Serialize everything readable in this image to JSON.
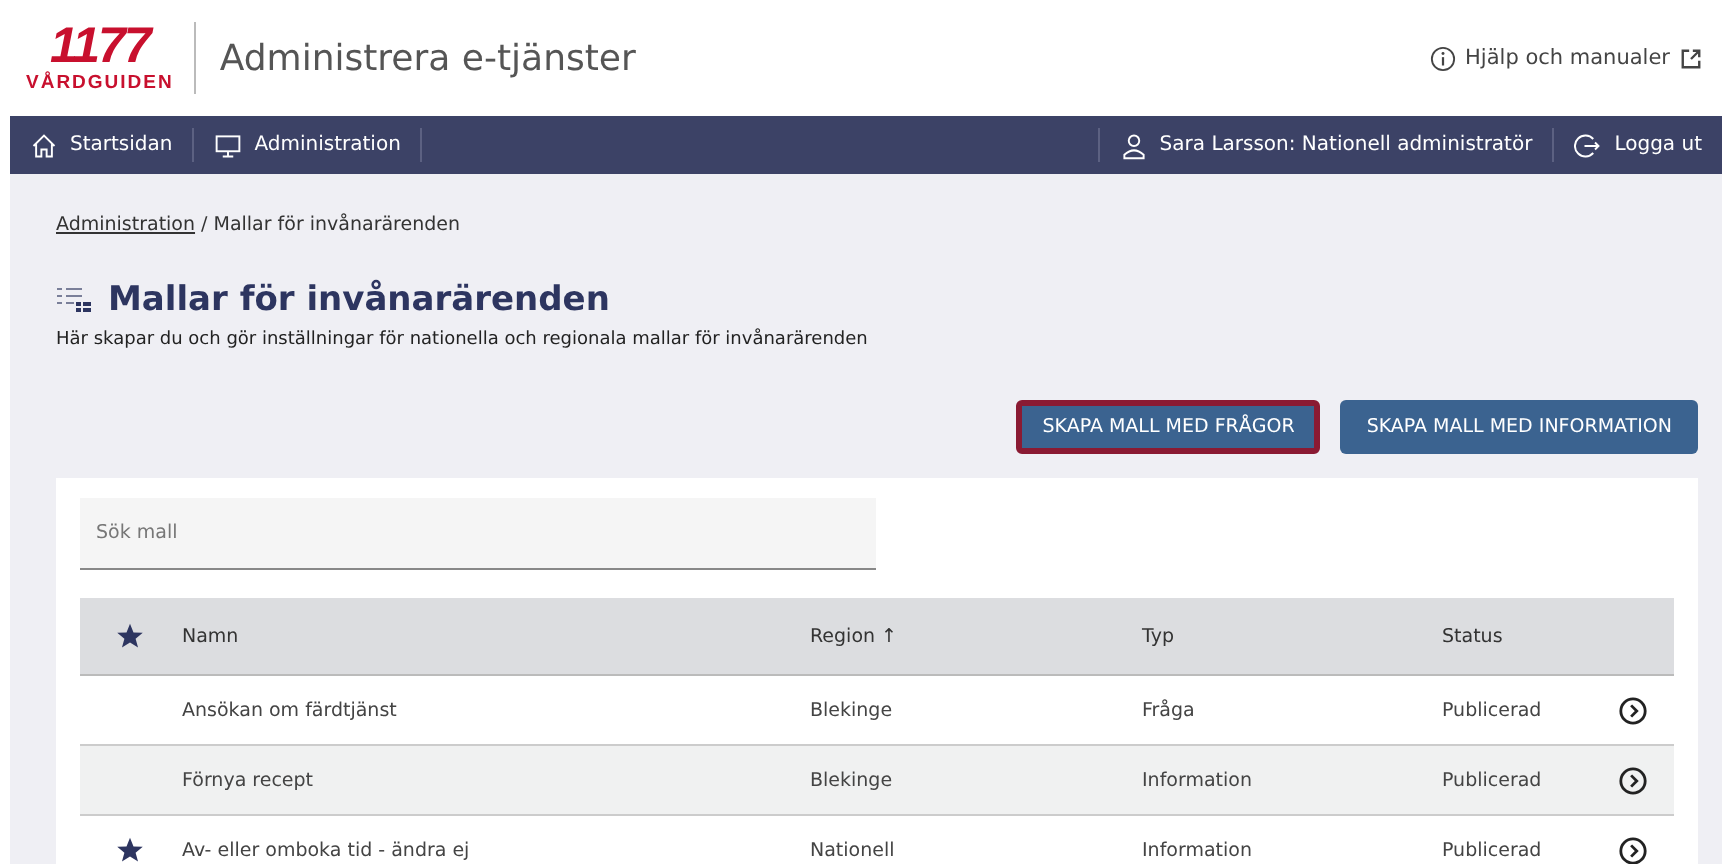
{
  "logo": {
    "number": "1177",
    "name": "VÅRDGUIDEN"
  },
  "app_title": "Administrera e-tjänster",
  "help_link": "Hjälp och manualer",
  "nav": {
    "left": [
      {
        "kind": "home",
        "label": "Startsidan"
      },
      {
        "kind": "monitor",
        "label": "Administration"
      }
    ],
    "right": [
      {
        "kind": "user",
        "label": "Sara Larsson: Nationell administratör"
      },
      {
        "kind": "logout",
        "label": "Logga ut"
      }
    ]
  },
  "breadcrumb": {
    "link": "Administration",
    "current": " / Mallar för invånarärenden"
  },
  "page": {
    "title": "Mallar för invånarärenden",
    "description": "Här skapar du och gör inställningar för nationella och regionala mallar för invånarärenden"
  },
  "buttons": [
    {
      "label": "SKAPA MALL MED FRÅGOR",
      "highlighted": true
    },
    {
      "label": "SKAPA MALL MED INFORMATION",
      "highlighted": false
    }
  ],
  "search": {
    "placeholder": "Sök mall"
  },
  "table": {
    "columns": [
      "Namn",
      "Region ↑",
      "Typ",
      "Status"
    ],
    "rows": [
      {
        "favorite": false,
        "name": "Ansökan om färdtjänst",
        "region": "Blekinge",
        "type": "Fråga",
        "status": "Publicerad"
      },
      {
        "favorite": false,
        "name": "Förnya recept",
        "region": "Blekinge",
        "type": "Information",
        "status": "Publicerad"
      },
      {
        "favorite": true,
        "name": "Av- eller omboka tid - ändra ej",
        "region": "Nationell",
        "type": "Information",
        "status": "Publicerad"
      }
    ]
  }
}
